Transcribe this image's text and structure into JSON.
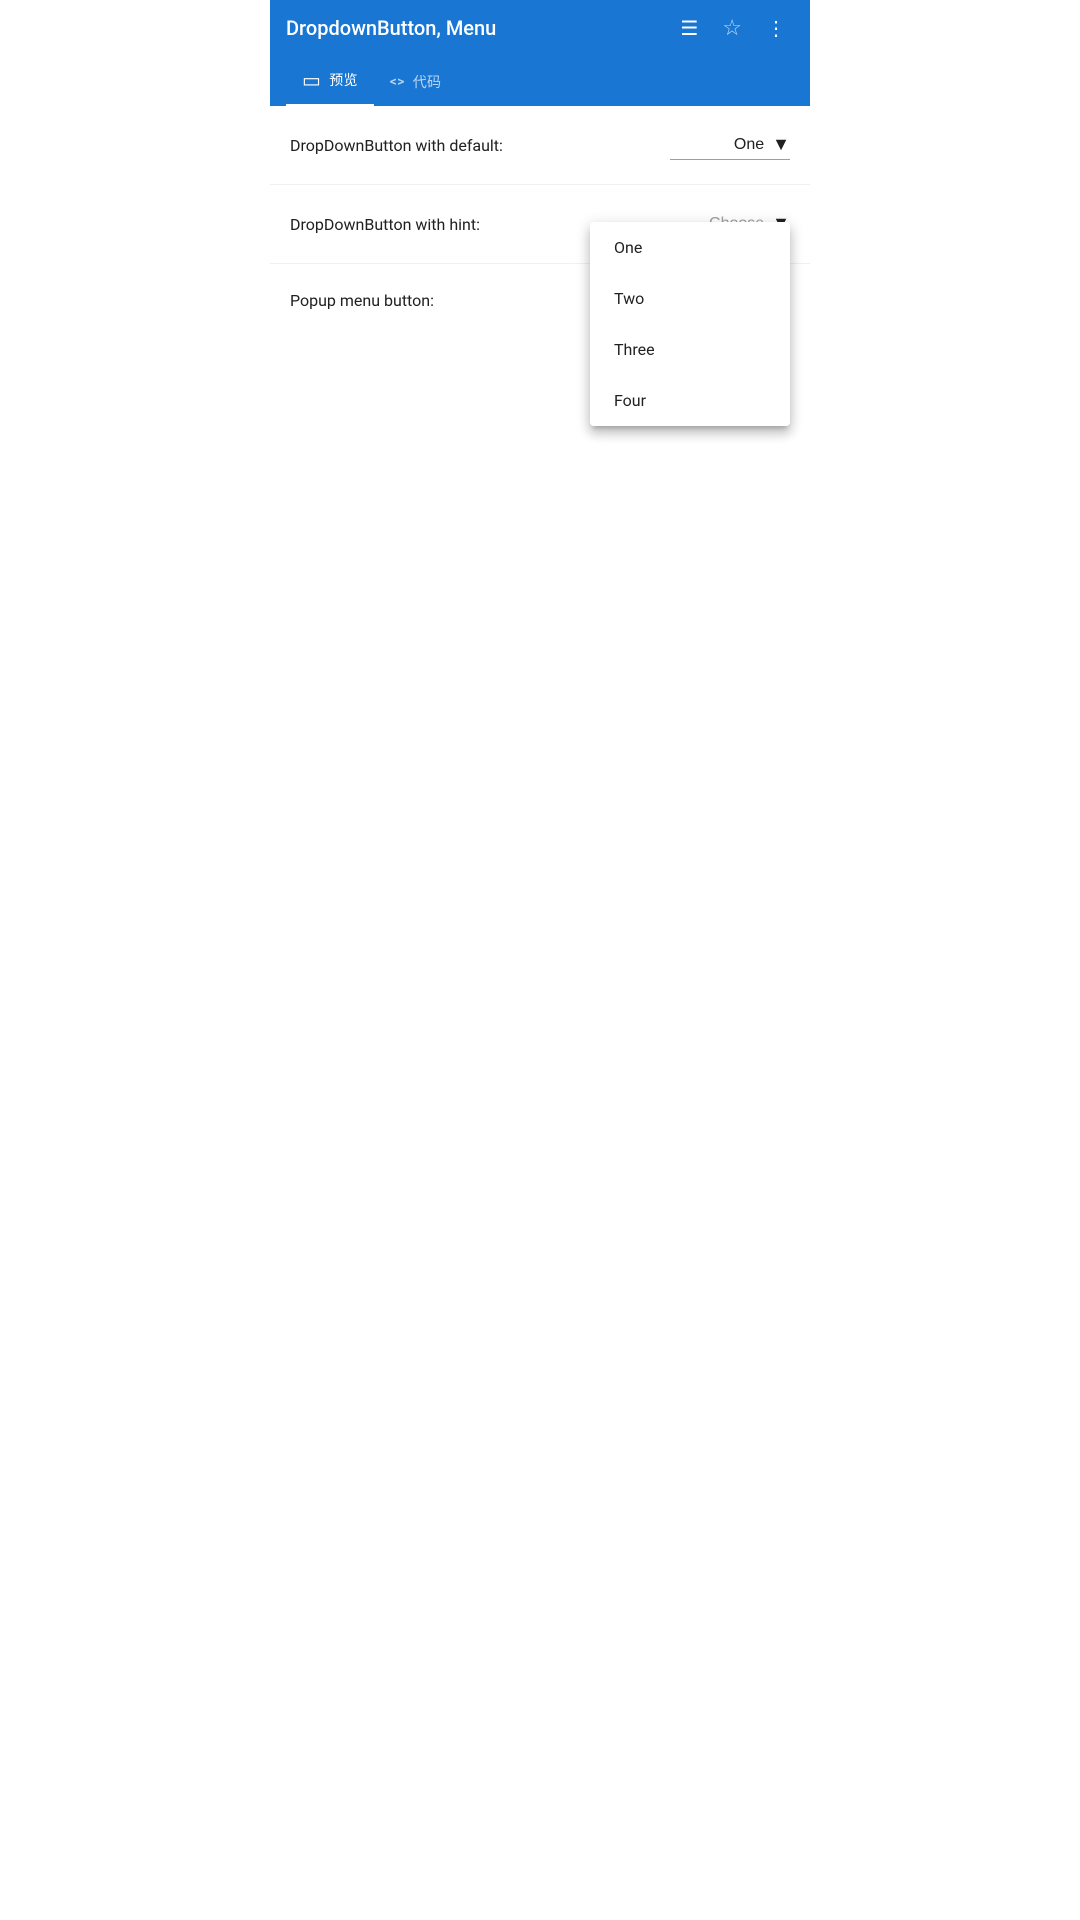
{
  "appBar": {
    "title": "DropdownButton, Menu",
    "hamburgerIcon": "☰",
    "starIcon": "☆",
    "dotsIcon": "⋮"
  },
  "tabs": [
    {
      "id": "preview",
      "label": "预览",
      "icon": "tablet",
      "active": true
    },
    {
      "id": "code",
      "label": "代码",
      "icon": "code",
      "active": false
    }
  ],
  "rows": [
    {
      "id": "default",
      "label": "DropDownButton with default:",
      "value": "One",
      "hint": null
    },
    {
      "id": "hint",
      "label": "DropDownButton with hint:",
      "value": null,
      "hint": "Choose"
    },
    {
      "id": "popup",
      "label": "Popup menu button:",
      "value": null,
      "hint": null
    }
  ],
  "dropdownMenu": {
    "items": [
      {
        "id": "one",
        "label": "One"
      },
      {
        "id": "two",
        "label": "Two"
      },
      {
        "id": "three",
        "label": "Three"
      },
      {
        "id": "four",
        "label": "Four"
      }
    ]
  }
}
